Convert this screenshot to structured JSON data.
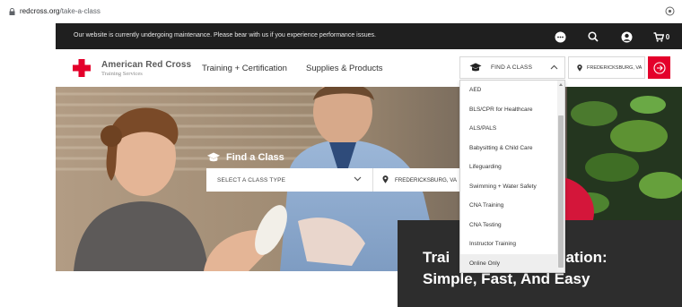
{
  "browser": {
    "url_host": "redcross.org",
    "url_path": "/take-a-class"
  },
  "notice": {
    "message": "Our website is currently undergoing maintenance. Please bear with us if you experience performance issues.",
    "cart_count": "0"
  },
  "header": {
    "logo_line1": "American Red Cross",
    "logo_line2": "Training Services",
    "nav": [
      "Training + Certification",
      "Supplies & Products"
    ],
    "find_class_label": "FIND A CLASS",
    "location_label": "FREDERICKSBURG, VA"
  },
  "hero": {
    "find_class_title": "Find a Class",
    "select_placeholder": "SELECT A CLASS TYPE",
    "location": "FREDERICKSBURG, VA",
    "tagline_line1": "Trai",
    "tagline_line1_end": "cation:",
    "tagline_line2": "Simple, Fast, And Easy"
  },
  "dropdown": {
    "items": [
      "AED",
      "BLS/CPR for Healthcare",
      "ALS/PALS",
      "Babysitting & Child Care",
      "Lifeguarding",
      "Swimming + Water Safety",
      "CNA Training",
      "CNA Testing",
      "Instructor Training",
      "Online Only"
    ],
    "highlighted_index": 9
  },
  "colors": {
    "brand_red": "#e4002b",
    "notice_bg": "#1f1f1f",
    "tag_panel_bg": "#2d2d2d"
  }
}
